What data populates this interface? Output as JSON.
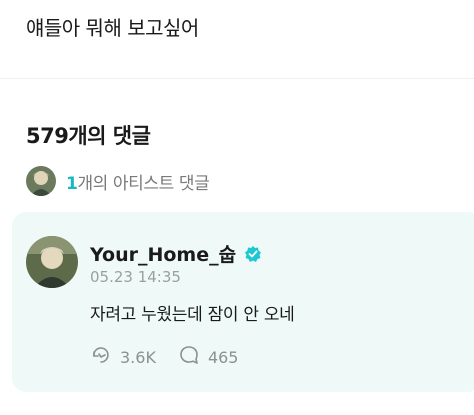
{
  "post": {
    "text": "얘들아 뭐해 보고싶어"
  },
  "comments": {
    "header": "579개의 댓글",
    "artist_count": "1",
    "artist_label": "개의 아티스트 댓글"
  },
  "comment": {
    "username": "Your_Home_숩",
    "timestamp": "05.23 14:35",
    "text": "자려고 누웠는데 잠이 안 오네",
    "likes": "3.6K",
    "replies": "465"
  },
  "icons": {
    "like": "refresh-hand-icon",
    "reply": "speech-bubble-icon",
    "verified": "verified-badge-icon"
  },
  "colors": {
    "accent": "#16b8c6",
    "card_bg": "#eef9f8",
    "muted": "#8c9191"
  }
}
